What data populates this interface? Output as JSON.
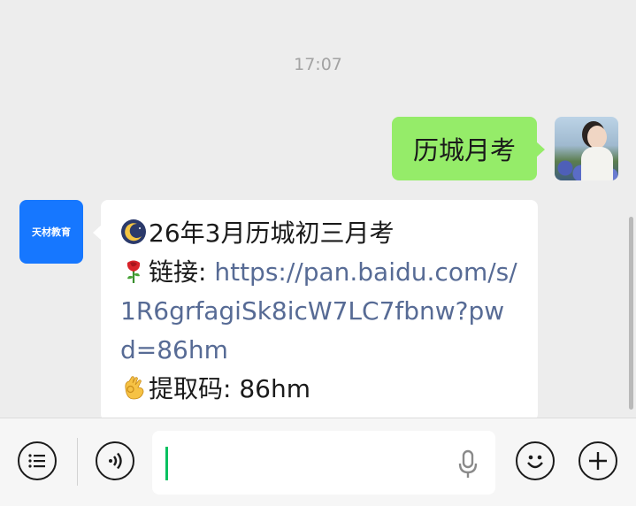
{
  "timestamp": "17:07",
  "outgoing": {
    "text": "历城月考"
  },
  "incoming": {
    "sender_logo_text": "天材教育",
    "line1": "26年3月历城初三月考",
    "link_label": "链接: ",
    "link_url": "https://pan.baidu.com/s/1R6grfagiSk8icW7LC7fbnw?pwd=86hm",
    "code_label": "提取码: 86hm"
  },
  "input": {
    "value": "",
    "placeholder": ""
  },
  "icons": {
    "menu": "list-icon",
    "voice": "voice-icon",
    "mic": "microphone-icon",
    "emoji": "emoji-icon",
    "more": "plus-icon",
    "moon": "moon-emoji-icon",
    "rose": "rose-emoji-icon",
    "ok": "ok-hand-emoji-icon"
  },
  "colors": {
    "outgoing_bubble": "#95ec69",
    "incoming_bubble": "#ffffff",
    "link": "#576b95",
    "logo_bg": "#1677ff"
  }
}
